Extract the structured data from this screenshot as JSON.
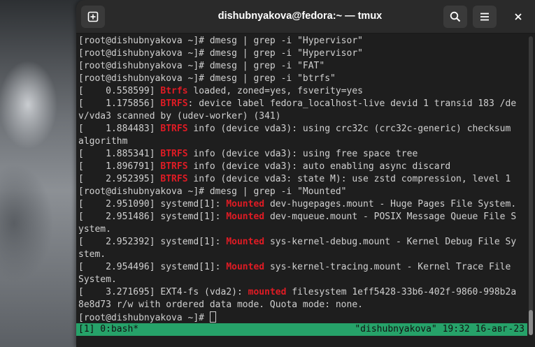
{
  "window": {
    "title": "dishubnyakova@fedora:~ — tmux"
  },
  "icons": {
    "new_tab": "new-tab-icon",
    "search": "search-icon",
    "menu": "hamburger-menu-icon",
    "close": "close-icon"
  },
  "colors": {
    "terminal_bg": "#1e1e1e",
    "highlight": "#e01b24",
    "status_bar": "#26a269"
  },
  "terminal": {
    "lines": [
      [
        {
          "t": "[root@dishubnyakova ~]# dmesg | grep -i \"Hypervisor\""
        }
      ],
      [
        {
          "t": "[root@dishubnyakova ~]# dmesg | grep -i \"Hypervisor\""
        }
      ],
      [
        {
          "t": "[root@dishubnyakova ~]# dmesg | grep -i \"FAT\""
        }
      ],
      [
        {
          "t": "[root@dishubnyakova ~]# dmesg | grep -i \"btrfs\""
        }
      ],
      [
        {
          "t": "[    0.558599] "
        },
        {
          "t": "Btrfs",
          "h": true
        },
        {
          "t": " loaded, zoned=yes, fsverity=yes"
        }
      ],
      [
        {
          "t": "[    1.175856] "
        },
        {
          "t": "BTRFS",
          "h": true
        },
        {
          "t": ": device label fedora_localhost-live devid 1 transid 183 /de"
        }
      ],
      [
        {
          "t": "v/vda3 scanned by (udev-worker) (341)"
        }
      ],
      [
        {
          "t": "[    1.884483] "
        },
        {
          "t": "BTRFS",
          "h": true
        },
        {
          "t": " info (device vda3): using crc32c (crc32c-generic) checksum"
        }
      ],
      [
        {
          "t": "algorithm"
        }
      ],
      [
        {
          "t": "[    1.885341] "
        },
        {
          "t": "BTRFS",
          "h": true
        },
        {
          "t": " info (device vda3): using free space tree"
        }
      ],
      [
        {
          "t": "[    1.896791] "
        },
        {
          "t": "BTRFS",
          "h": true
        },
        {
          "t": " info (device vda3): auto enabling async discard"
        }
      ],
      [
        {
          "t": "[    2.952395] "
        },
        {
          "t": "BTRFS",
          "h": true
        },
        {
          "t": " info (device vda3: state M): use zstd compression, level 1"
        }
      ],
      [
        {
          "t": "[root@dishubnyakova ~]# dmesg | grep -i \"Mounted\""
        }
      ],
      [
        {
          "t": "[    2.951090] systemd[1]: "
        },
        {
          "t": "Mounted",
          "h": true
        },
        {
          "t": " dev-hugepages.mount - Huge Pages File System."
        }
      ],
      [
        {
          "t": "[    2.951486] systemd[1]: "
        },
        {
          "t": "Mounted",
          "h": true
        },
        {
          "t": " dev-mqueue.mount - POSIX Message Queue File S"
        }
      ],
      [
        {
          "t": "ystem."
        }
      ],
      [
        {
          "t": "[    2.952392] systemd[1]: "
        },
        {
          "t": "Mounted",
          "h": true
        },
        {
          "t": " sys-kernel-debug.mount - Kernel Debug File Sy"
        }
      ],
      [
        {
          "t": "stem."
        }
      ],
      [
        {
          "t": "[    2.954496] systemd[1]: "
        },
        {
          "t": "Mounted",
          "h": true
        },
        {
          "t": " sys-kernel-tracing.mount - Kernel Trace File"
        }
      ],
      [
        {
          "t": "System."
        }
      ],
      [
        {
          "t": "[    3.271695] EXT4-fs (vda2): "
        },
        {
          "t": "mounted",
          "h": true
        },
        {
          "t": " filesystem 1eff5428-33b6-402f-9860-998b2a"
        }
      ],
      [
        {
          "t": "8e8d73 r/w with ordered data mode. Quota mode: none."
        }
      ]
    ],
    "prompt": "[root@dishubnyakova ~]# "
  },
  "tmux": {
    "left": "[1] 0:bash*",
    "right": "\"dishubnyakova\" 19:32 16-авг-23"
  }
}
